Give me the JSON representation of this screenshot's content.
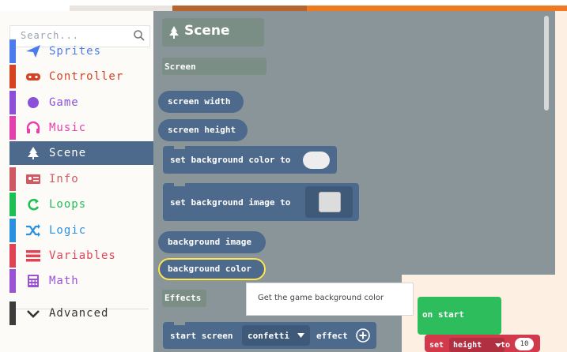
{
  "search": {
    "placeholder": "Search..."
  },
  "categories": [
    {
      "label": "Sprites",
      "icon": "paper-plane-icon",
      "color": "#4b7bec"
    },
    {
      "label": "Controller",
      "icon": "gamepad-icon",
      "color": "#d54322"
    },
    {
      "label": "Game",
      "icon": "circle-icon",
      "color": "#8b4fd8"
    },
    {
      "label": "Music",
      "icon": "headphones-icon",
      "color": "#e63fae"
    },
    {
      "label": "Scene",
      "icon": "tree-icon",
      "color": "#4d6a8c",
      "selected": true
    },
    {
      "label": "Info",
      "icon": "id-card-icon",
      "color": "#cf5a64"
    },
    {
      "label": "Loops",
      "icon": "loop-arrow-icon",
      "color": "#20bf55"
    },
    {
      "label": "Logic",
      "icon": "shuffle-icon",
      "color": "#2a90e0"
    },
    {
      "label": "Variables",
      "icon": "list-icon",
      "color": "#e04356"
    },
    {
      "label": "Math",
      "icon": "calculator-icon",
      "color": "#9a52d7"
    }
  ],
  "advanced": {
    "label": "Advanced",
    "icon": "chevron-down-icon",
    "color": "#3c3c3c"
  },
  "flyout": {
    "title": "Scene",
    "title_icon": "tree-icon",
    "sections": {
      "screen": "Screen",
      "effects": "Effects"
    },
    "blocks": {
      "screen_width": "screen width",
      "screen_height": "screen height",
      "set_bg_color": "set background color to",
      "set_bg_image": "set background image to",
      "background_image": "background image",
      "background_color": "background color",
      "start_screen": "start screen",
      "effect_value": "confetti",
      "effect_suffix": "effect"
    },
    "tooltip": "Get the game background color"
  },
  "workspace": {
    "on_start": "on start",
    "set_word": "set",
    "set_variable": "height",
    "set_to": "to",
    "set_value": "10"
  },
  "colors": {
    "scene_block": "#4d6a8c",
    "flyout_bg": "#8a9599",
    "highlight": "#ffe64f",
    "on_start": "#2ebd5c",
    "variables": "#d23a4c"
  }
}
